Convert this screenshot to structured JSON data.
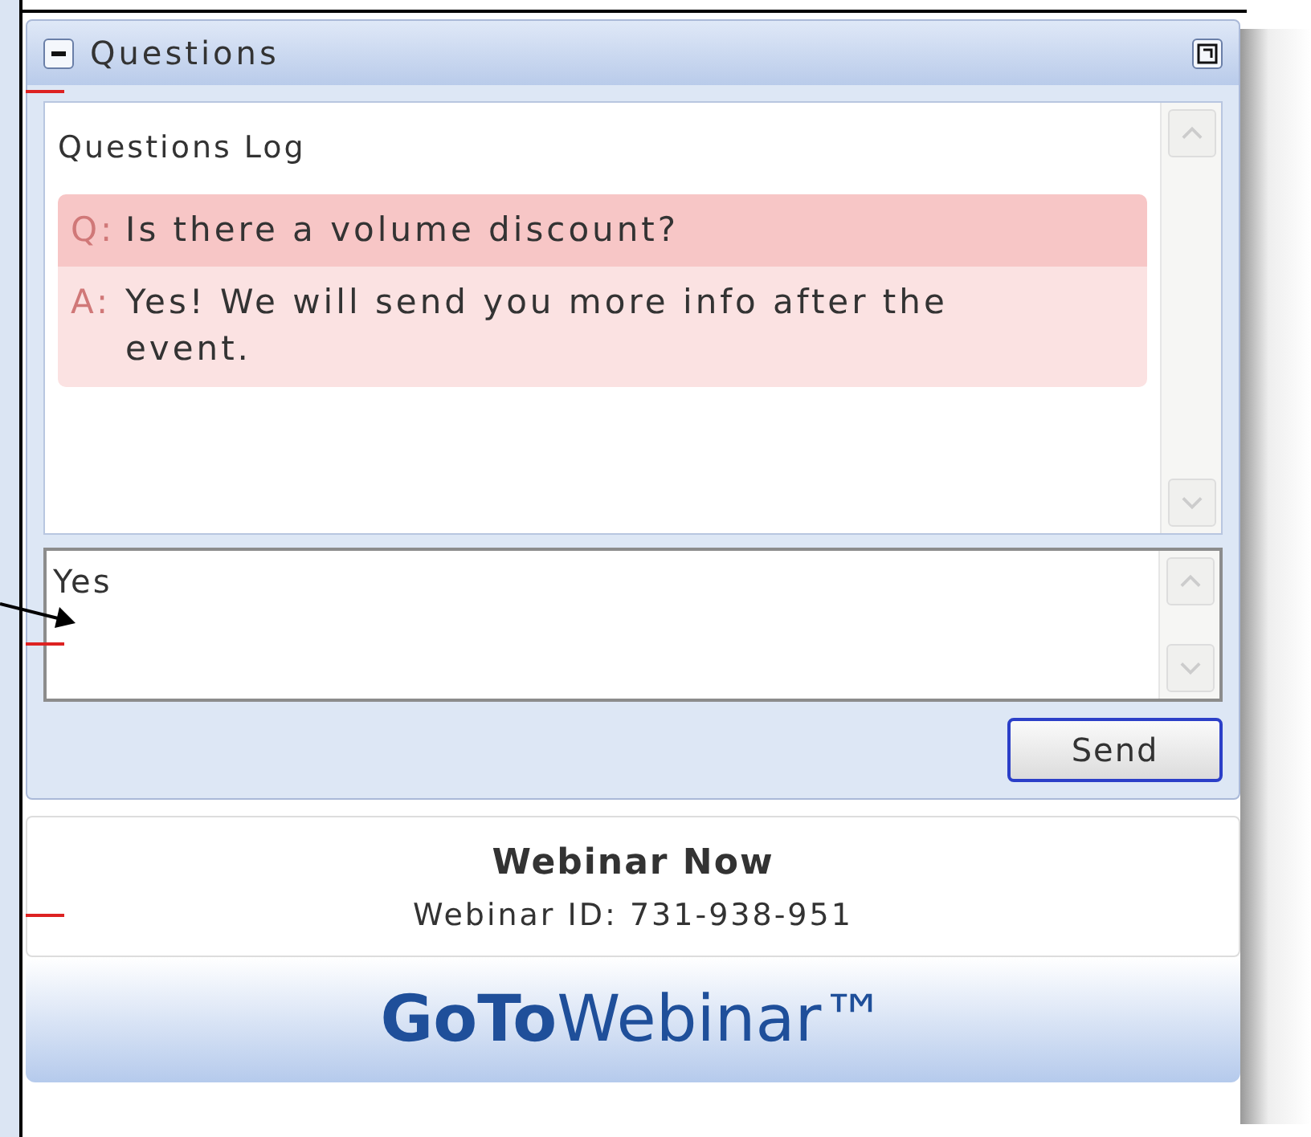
{
  "panel": {
    "title": "Questions"
  },
  "log": {
    "title": "Questions Log",
    "messages": [
      {
        "kind": "question",
        "prefix": "Q:",
        "text": "Is there a volume discount?"
      },
      {
        "kind": "answer",
        "prefix": "A:",
        "text": "Yes! We will send you more info after the event."
      }
    ]
  },
  "input": {
    "value": "Yes"
  },
  "send_button": "Send",
  "event": {
    "title": "Webinar Now",
    "webinar_id": "Webinar ID: 731-938-951"
  },
  "logo": "**GoTo**Webinar™"
}
